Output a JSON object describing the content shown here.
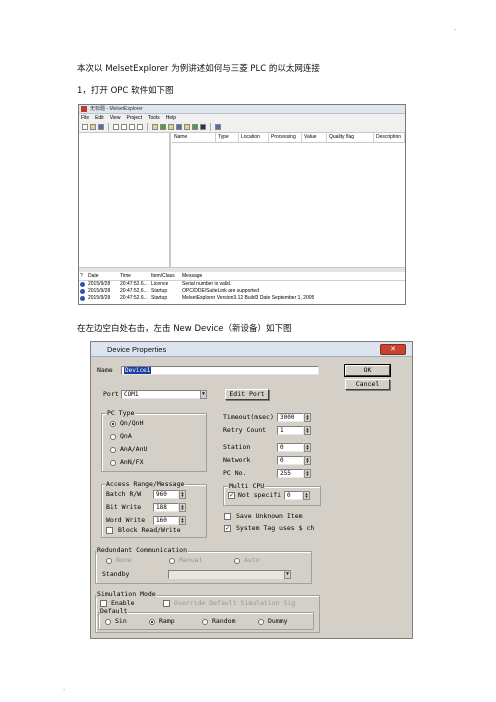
{
  "top_dot": ".",
  "bottom_dot": ".",
  "intro_text": "本次以 MelsetExplorer 为例讲述如何与三菱 PLC 的以太网连接",
  "step1_text": "1，打开 OPC 软件如下图",
  "step2_text": "在左边空白处右击，左击 New Device（新设备）如下图",
  "explorer": {
    "title": "无标题 - MelsetExplorer",
    "menu": [
      "File",
      "Edit",
      "View",
      "Project",
      "Tools",
      "Help"
    ],
    "columns": [
      "Name",
      "Type",
      "Location",
      "Processing",
      "Value",
      "Quality flag",
      "Description"
    ],
    "log_columns": [
      "?",
      "Date",
      "Time",
      "Item/Class",
      "Message"
    ],
    "log_rows": [
      {
        "date": "2015/9/28",
        "time": "20:47:52.6...",
        "class": "Licence",
        "message": "Serial number is valid."
      },
      {
        "date": "2015/9/28",
        "time": "20:47:52.6...",
        "class": "Startup",
        "message": "OPC/DDE/SuiteLink are supported"
      },
      {
        "date": "2015/9/28",
        "time": "20:47:52.6...",
        "class": "Startup",
        "message": "MelsetExplorer Version3.12 Build3 Date September 1, 2005"
      }
    ]
  },
  "device": {
    "title": "Device Properties",
    "name_label": "Name",
    "name_value": "Device1",
    "port_label": "Port",
    "port_value": "COM1",
    "edit_port": "Edit Port",
    "ok": "OK",
    "cancel": "Cancel",
    "pc_type": {
      "label": "PC Type",
      "options": [
        "Qn/QnH",
        "QnA",
        "AnA/AnU",
        "AnN/FX"
      ],
      "selected": 0
    },
    "access": {
      "label": "Access Range/Message",
      "batch_label": "Batch R/W",
      "batch_value": "960",
      "bit_label": "Bit Write",
      "bit_value": "188",
      "word_label": "Word Write",
      "word_value": "160",
      "block_label": "Block Read/Write"
    },
    "timeout_label": "Timeout(msec)",
    "timeout_value": "3000",
    "retry_label": "Retry Count",
    "retry_value": "1",
    "station_label": "Station",
    "station_value": "0",
    "network_label": "Network",
    "network_value": "0",
    "pcno_label": "PC No.",
    "pcno_value": "255",
    "multi_cpu": {
      "label": "Multi CPU",
      "check_label": "Not specifi",
      "value": "0"
    },
    "save_unknown": "Save Unknown Item",
    "system_tag": "System Tag uses $ ch",
    "redundant": {
      "label": "Redundant Communication",
      "options": [
        "None",
        "Manual",
        "Auto"
      ],
      "standby_label": "Standby"
    },
    "simulation": {
      "label": "Simulation Mode",
      "enable": "Enable",
      "override": "Override Default Simulation Sig",
      "default_label": "Default",
      "options": [
        "Sin",
        "Ramp",
        "Random",
        "Dummy"
      ],
      "selected": 1
    }
  }
}
